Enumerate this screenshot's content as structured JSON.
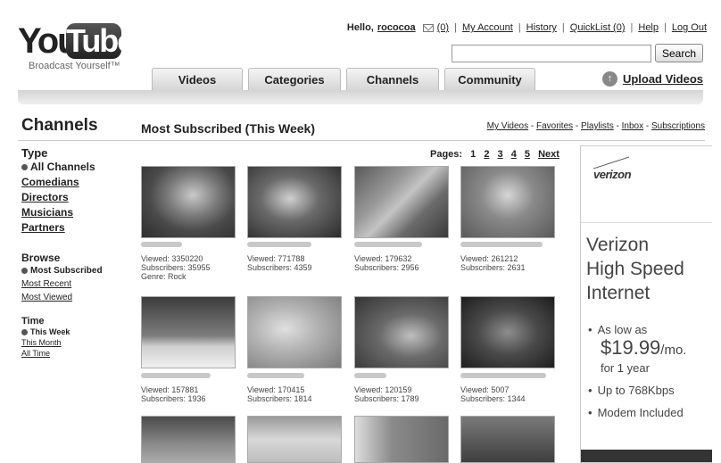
{
  "logo": {
    "you": "You",
    "tube": "Tube",
    "tagline": "Broadcast Yourself™"
  },
  "userbar": {
    "hello": "Hello,",
    "username": "rococoa",
    "inbox_count": "(0)",
    "links": [
      "My Account",
      "History",
      "QuickList (0)",
      "Help",
      "Log Out"
    ]
  },
  "search": {
    "button": "Search",
    "placeholder": ""
  },
  "tabs": [
    "Videos",
    "Categories",
    "Channels",
    "Community"
  ],
  "upload": "Upload Videos",
  "page_title": "Channels",
  "section_title": "Most Subscribed (This Week)",
  "my_links": [
    "My Videos",
    "Favorites",
    "Playlists",
    "Inbox",
    "Subscriptions"
  ],
  "sidebar": {
    "type": {
      "heading": "Type",
      "active": "All Channels",
      "items": [
        "Comedians",
        "Directors",
        "Musicians",
        "Partners"
      ]
    },
    "browse": {
      "heading": "Browse",
      "active": "Most Subscribed",
      "items": [
        "Most Recent",
        "Most Viewed"
      ]
    },
    "time": {
      "heading": "Time",
      "active": "This Week",
      "items": [
        "This Month",
        "All Time"
      ]
    }
  },
  "pagination": {
    "label": "Pages:",
    "current": "1",
    "pages": [
      "2",
      "3",
      "4",
      "5"
    ],
    "next": "Next"
  },
  "channels": [
    {
      "viewed": "Viewed: 3350220",
      "subscribers": "Subscribers: 35955",
      "genre": "Genre: Rock"
    },
    {
      "viewed": "Viewed: 771788",
      "subscribers": "Subscribers: 4359"
    },
    {
      "viewed": "Viewed: 179632",
      "subscribers": "Subscribers: 2956"
    },
    {
      "viewed": "Viewed: 261212",
      "subscribers": "Subscribers: 2631"
    },
    {
      "viewed": "Viewed: 157881",
      "subscribers": "Subscribers: 1936"
    },
    {
      "viewed": "Viewed: 170415",
      "subscribers": "Subscribers: 1814"
    },
    {
      "viewed": "Viewed: 120159",
      "subscribers": "Subscribers: 1789"
    },
    {
      "viewed": "Viewed: 5007",
      "subscribers": "Subscribers: 1344"
    }
  ],
  "ad": {
    "brand": "verizon",
    "headline": [
      "Verizon",
      "High Speed",
      "Internet"
    ],
    "bullet1_pre": "As low as",
    "price": "$19.99",
    "price_unit": "/mo.",
    "price_sub": "for 1 year",
    "bullet2": "Up to 768Kbps",
    "bullet3": "Modem Included"
  }
}
